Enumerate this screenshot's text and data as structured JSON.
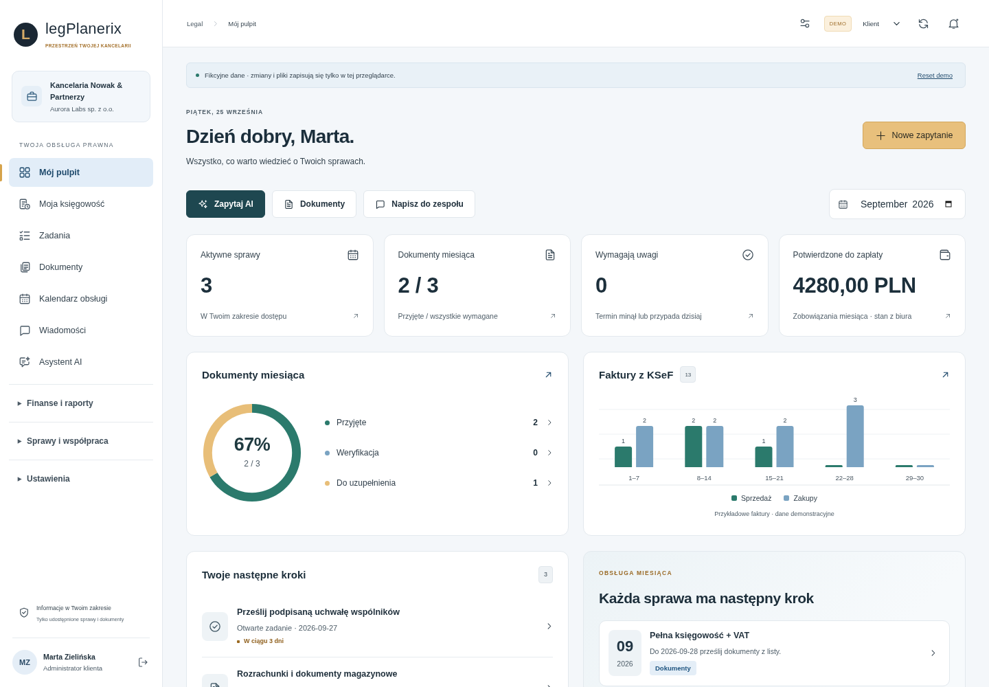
{
  "brand": {
    "logo_letter": "L",
    "name": "legPlanerix",
    "tagline": "PRZESTRZEŃ TWOJEJ KANCELARII"
  },
  "organization": {
    "name": "Kancelaria Nowak & Partnerzy",
    "company": "Aurora Labs sp. z o.o."
  },
  "sidebar": {
    "section_label": "TWOJA OBSŁUGA PRAWNA",
    "items": [
      {
        "label": "Mój pulpit",
        "selected": true
      },
      {
        "label": "Moja księgowość",
        "selected": false
      },
      {
        "label": "Zadania",
        "selected": false
      },
      {
        "label": "Dokumenty",
        "selected": false
      },
      {
        "label": "Kalendarz obsługi",
        "selected": false
      },
      {
        "label": "Wiadomości",
        "selected": false
      },
      {
        "label": "Asystent AI",
        "selected": false
      }
    ],
    "groups": [
      {
        "label": "Finanse i raporty",
        "expanded": false
      },
      {
        "label": "Sprawy i współpraca",
        "expanded": false
      },
      {
        "label": "Ustawienia",
        "expanded": false
      }
    ],
    "scope_note": {
      "title": "Informacje w Twoim zakresie",
      "text": "Tylko udostępnione sprawy i dokumenty"
    },
    "user": {
      "initials": "MZ",
      "name": "Marta Zielińska",
      "role": "Administrator klienta"
    }
  },
  "header": {
    "breadcrumb": [
      "Legal",
      "Mój pulpit"
    ],
    "badge": "DEMO",
    "role_select": "Klient"
  },
  "notice": {
    "text": "Fikcyjne dane · zmiany i pliki zapisują się tylko w tej przeglądarce.",
    "link": "Reset demo"
  },
  "greeting": {
    "date": "PIĄTEK, 25 WRZEŚNIA",
    "title": "Dzień dobry, Marta.",
    "subtitle": "Wszystko, co warto wiedzieć o Twoich sprawach.",
    "primary_button": "Nowe zapytanie"
  },
  "actions": [
    {
      "label": "Zapytaj AI",
      "kind": "primary"
    },
    {
      "label": "Dokumenty",
      "kind": "secondary"
    },
    {
      "label": "Napisz do zespołu",
      "kind": "secondary"
    }
  ],
  "month_field": {
    "value": "September 2026"
  },
  "stats": [
    {
      "title": "Aktywne sprawy",
      "value": "3",
      "note": "W Twoim zakresie dostępu"
    },
    {
      "title": "Dokumenty miesiąca",
      "value": "2 / 3",
      "note": "Przyjęte / wszystkie wymagane"
    },
    {
      "title": "Wymagają uwagi",
      "value": "0",
      "note": "Termin minął lub przypada dzisiaj"
    },
    {
      "title": "Potwierdzone do zapłaty",
      "value": "4280,00 PLN",
      "note": "Zobowiązania miesiąca · stan z biura"
    }
  ],
  "documents_card": {
    "title": "Dokumenty miesiąca",
    "center_value": "67%",
    "center_caption": "2 / 3",
    "chart_data": {
      "type": "donut",
      "categories": [
        "Przyjęte",
        "Weryfikacja",
        "Do uzupełnienia"
      ],
      "values": [
        66.7,
        0,
        33.3
      ]
    },
    "legend": [
      {
        "color": "#2b7a6c",
        "count": "2"
      },
      {
        "color": "#7aa3c2",
        "count": "0"
      },
      {
        "color": "#e8be78",
        "count": "1"
      }
    ]
  },
  "invoices_card": {
    "title": "Faktury z KSeF",
    "count": "13",
    "chart_data": {
      "type": "bar",
      "categories": [
        "1–7",
        "8–14",
        "15–21",
        "22–28",
        "29–30"
      ],
      "series": [
        {
          "name": "Sprzedaż",
          "color": "#2b7a6c",
          "values": [
            1,
            2,
            1,
            0,
            0
          ],
          "value_labels": [
            "1",
            "2",
            "1",
            null,
            null
          ]
        },
        {
          "name": "Zakupy",
          "color": "#7aa3c2",
          "values": [
            2,
            2,
            2,
            3,
            0
          ],
          "value_labels": [
            "2",
            "2",
            "2",
            "3",
            null
          ]
        }
      ]
    },
    "caption": "Przykładowe faktury · dane demonstracyjne"
  },
  "next_steps": {
    "title": "Twoje następne kroki",
    "count": "3",
    "items": [
      {
        "kind": "task",
        "title": "Prześlij podpisaną uchwałę wspólników",
        "meta": "Otwarte zadanie · 2026-09-27",
        "due": "W ciągu 3 dni"
      },
      {
        "kind": "document",
        "title": "Rozrachunki i dokumenty magazynowe"
      }
    ]
  },
  "monthly": {
    "eyebrow": "OBSŁUGA MIESIĄCA",
    "title": "Każda sprawa ma następny krok",
    "items": [
      {
        "month": "09",
        "year": "2026",
        "title": "Pełna księgowość + VAT",
        "text": "Do 2026-09-28 prześlij dokumenty z listy.",
        "tag": "Dokumenty"
      }
    ]
  }
}
